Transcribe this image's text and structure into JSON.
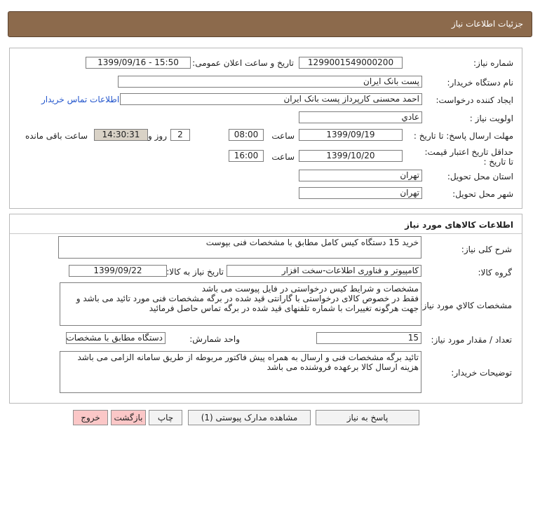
{
  "page_title": "جزئیات اطلاعات نیاز",
  "info": {
    "need_number_label": "شماره نیاز:",
    "need_number": "1299001549000200",
    "announce_datetime_label": "تاریخ و ساعت اعلان عمومی:",
    "announce_datetime": "1399/09/16 - 15:50",
    "buyer_org_label": "نام دستگاه خریدار:",
    "buyer_org": "پست بانک ایران",
    "requester_label": "ایجاد کننده درخواست:",
    "requester": "احمد  محسنی کارپرداز پست بانک ایران",
    "contact_link": "اطلاعات تماس خریدار",
    "priority_label": "اولویت نیاز :",
    "priority": "عادي",
    "reply_deadline_label": "مهلت ارسال پاسخ: تا تاریخ :",
    "reply_date": "1399/09/19",
    "time_label": "ساعت",
    "reply_time": "08:00",
    "days_value": "2",
    "days_label": "روز و",
    "remaining_time": "14:30:31",
    "remaining_label": "ساعت باقی مانده",
    "price_validity_label": "حداقل تاریخ اعتبار قیمت:",
    "price_validity_to": "تا تاریخ :",
    "validity_date": "1399/10/20",
    "validity_time": "16:00",
    "province_label": "استان محل تحویل:",
    "province": "تهران",
    "city_label": "شهر محل تحویل:",
    "city": "تهران"
  },
  "goods": {
    "section_title": "اطلاعات کالاهای مورد نیاز",
    "summary_label": "شرح کلی نیاز:",
    "summary": "خرید 15 دستگاه کیس کامل مطابق با مشخصات فنی بپوست",
    "group_label": "گروه کالا:",
    "group": "کامپیوتر و فناوری اطلاعات-سخت افزار",
    "need_date_label": "تاریخ نیاز به کالا:",
    "need_date": "1399/09/22",
    "specs_label": "مشخصات کالاي مورد نياز:",
    "specs_lines": [
      "مشخصات و شرایط کیس درخواستی در فایل پیوست می باشد",
      "فقط در خصوص کالای درخواستی با گارانتی قید شده در برگه مشخصات فنی مورد تائید می باشد و",
      "جهت هرگونه تغییرات با شماره تلفنهای قید شده در برگه تماس حاصل فرمائید"
    ],
    "qty_label": "تعداد / مقدار مورد نیاز:",
    "qty": "15",
    "unit_label": "واحد شمارش:",
    "unit": "دستگاه مطابق با مشخصات",
    "buyer_notes_label": "توضیحات خریدار:",
    "buyer_notes_lines": [
      "تائید برگه مشخصات فنی و ارسال به همراه پیش فاکتور مربوطه از طریق سامانه الزامی می باشد",
      "هزینه ارسال کالا برعهده فروشنده می باشد"
    ]
  },
  "buttons": {
    "reply": "پاسخ به نیاز",
    "attachments": "مشاهده مدارک پیوستی (1)",
    "print": "چاپ",
    "back": "بازگشت",
    "exit": "خروج"
  }
}
